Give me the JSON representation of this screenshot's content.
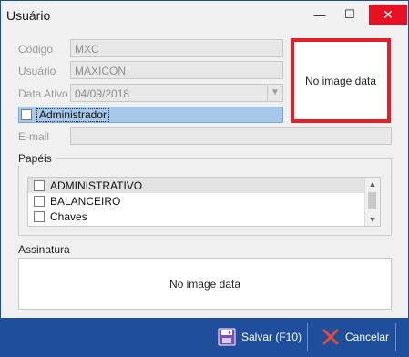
{
  "window": {
    "title": "Usuário",
    "min": "—",
    "max": "☐",
    "close": "✕"
  },
  "form": {
    "codigo_label": "Código",
    "codigo_value": "MXC",
    "usuario_label": "Usuário",
    "usuario_value": "MAXICON",
    "data_ativo_label": "Data Ativo",
    "data_ativo_value": "04/09/2018",
    "admin_label": "Administrador",
    "email_label": "E-mail",
    "email_value": "",
    "image_placeholder": "No image data"
  },
  "papeis": {
    "title": "Papéis",
    "items": [
      "ADMINISTRATIVO",
      "BALANCEIRO",
      "Chaves"
    ]
  },
  "assinatura": {
    "title": "Assinatura",
    "placeholder": "No image data"
  },
  "footer": {
    "save_label": "Salvar (F10)",
    "cancel_label": "Cancelar"
  },
  "colors": {
    "accent": "#1f4f9c",
    "close": "#e81123",
    "image_border": "#e0202a",
    "selection": "#a7c8e8"
  }
}
